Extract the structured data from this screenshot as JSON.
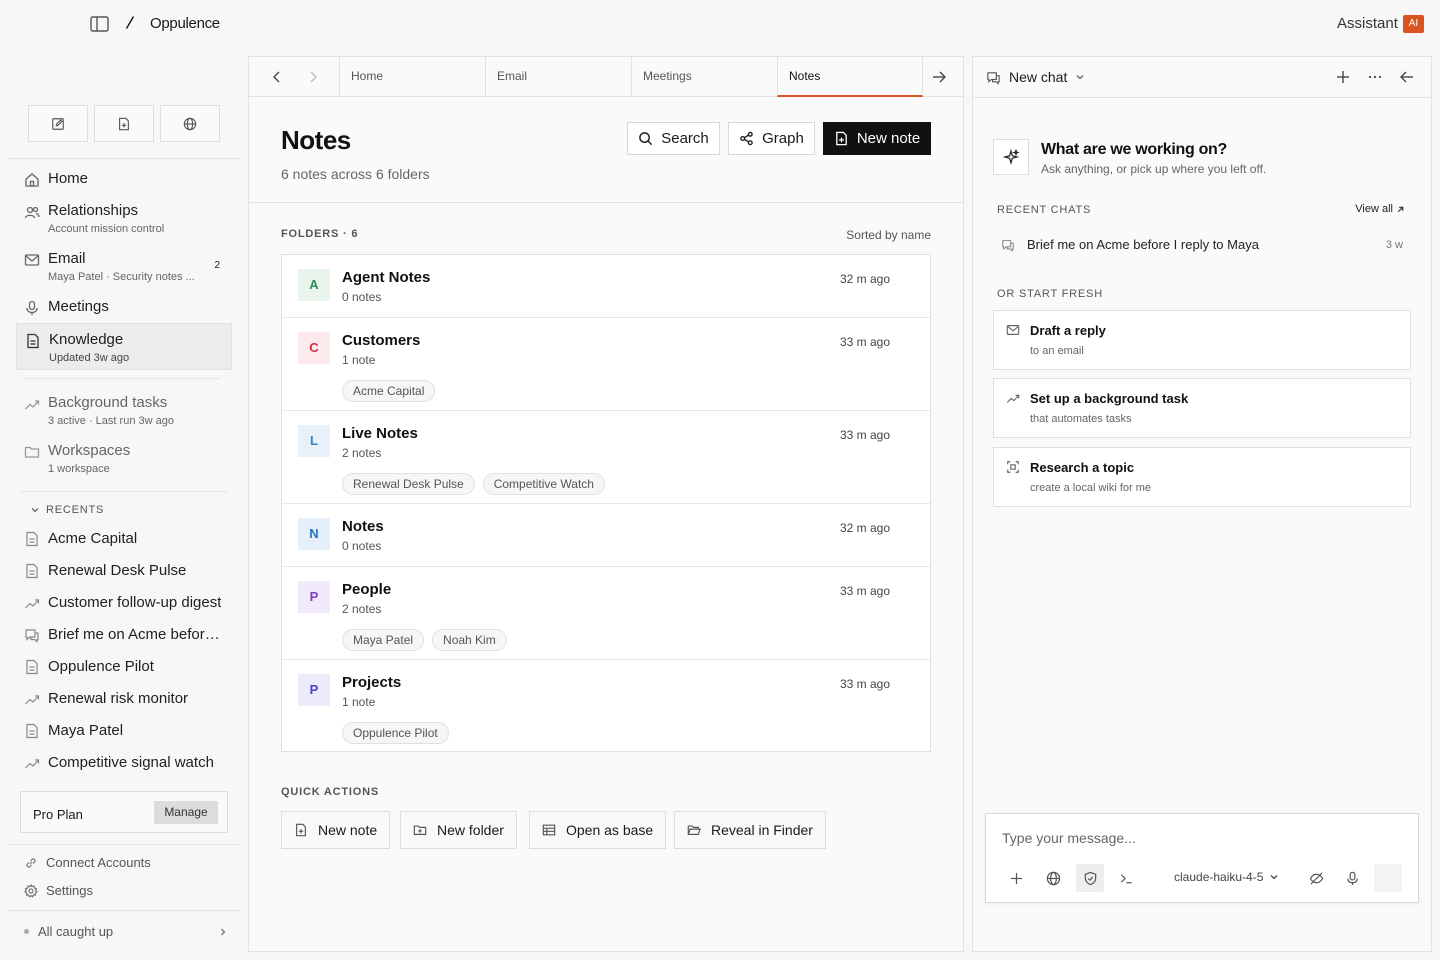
{
  "app": {
    "name": "Oppulence",
    "assistant_label": "Assistant",
    "assistant_badge": "AI"
  },
  "sidebar": {
    "quick_icons": [
      "compose-icon",
      "new-document-icon",
      "globe-icon"
    ],
    "nav": [
      {
        "label": "Home",
        "sub": "",
        "icon": "home-icon"
      },
      {
        "label": "Relationships",
        "sub": "Account mission control",
        "icon": "users-icon"
      },
      {
        "label": "Email",
        "sub": "Maya Patel · Security notes ...",
        "badge": "2",
        "icon": "mail-icon"
      },
      {
        "label": "Meetings",
        "sub": "",
        "icon": "mic-icon"
      },
      {
        "label": "Knowledge",
        "sub": "Updated 3w ago",
        "icon": "document-icon",
        "active": true
      },
      {
        "label": "Background tasks",
        "sub": "3 active · Last run 3w ago",
        "icon": "trend-icon"
      },
      {
        "label": "Workspaces",
        "sub": "1 workspace",
        "icon": "folder-icon"
      }
    ],
    "recents_header": "RECENTS",
    "recents": [
      {
        "label": "Acme Capital",
        "icon": "document-icon"
      },
      {
        "label": "Renewal Desk Pulse",
        "icon": "document-icon"
      },
      {
        "label": "Customer follow-up digest",
        "icon": "trend-icon"
      },
      {
        "label": "Brief me on Acme before I reply to Maya",
        "icon": "chat-icon"
      },
      {
        "label": "Oppulence Pilot",
        "icon": "document-icon"
      },
      {
        "label": "Renewal risk monitor",
        "icon": "trend-icon"
      },
      {
        "label": "Maya Patel",
        "icon": "document-icon"
      },
      {
        "label": "Competitive signal watch",
        "icon": "trend-icon"
      }
    ],
    "plan": {
      "label": "Pro Plan",
      "button": "Manage"
    },
    "footer": {
      "connect": "Connect Accounts",
      "settings": "Settings",
      "status": "All caught up"
    }
  },
  "tabs": [
    {
      "label": "Home",
      "active": false
    },
    {
      "label": "Email",
      "active": false
    },
    {
      "label": "Meetings",
      "active": false
    },
    {
      "label": "Notes",
      "active": true
    }
  ],
  "page": {
    "title": "Notes",
    "subtitle": "6 notes across 6 folders",
    "buttons": {
      "search": "Search",
      "graph": "Graph",
      "new_note": "New note"
    },
    "folders_header": "FOLDERS · 6",
    "sort_label": "Sorted by name",
    "folders": [
      {
        "initial": "A",
        "name": "Agent Notes",
        "count": "0 notes",
        "time": "32 m ago",
        "color": "#2e8b57",
        "bg": "#e8f4ec",
        "chips": []
      },
      {
        "initial": "C",
        "name": "Customers",
        "count": "1 note",
        "time": "33 m ago",
        "color": "#d32f45",
        "bg": "#fbe9ec",
        "chips": [
          "Acme Capital"
        ]
      },
      {
        "initial": "L",
        "name": "Live Notes",
        "count": "2 notes",
        "time": "33 m ago",
        "color": "#3b7ec8",
        "bg": "#e8f1fa",
        "chips": [
          "Renewal Desk Pulse",
          "Competitive Watch"
        ]
      },
      {
        "initial": "N",
        "name": "Notes",
        "count": "0 notes",
        "time": "32 m ago",
        "color": "#2a73c2",
        "bg": "#e6f0fa",
        "chips": []
      },
      {
        "initial": "P",
        "name": "People",
        "count": "2 notes",
        "time": "33 m ago",
        "color": "#7a3fc4",
        "bg": "#f1eafa",
        "chips": [
          "Maya Patel",
          "Noah Kim"
        ]
      },
      {
        "initial": "P",
        "name": "Projects",
        "count": "1 note",
        "time": "33 m ago",
        "color": "#4b3ec4",
        "bg": "#ecebfa",
        "chips": [
          "Oppulence Pilot"
        ]
      }
    ],
    "quick_actions_header": "QUICK ACTIONS",
    "quick_actions": [
      {
        "label": "New note",
        "icon": "new-document-icon"
      },
      {
        "label": "New folder",
        "icon": "new-folder-icon"
      },
      {
        "label": "Open as base",
        "icon": "table-icon"
      },
      {
        "label": "Reveal in Finder",
        "icon": "folder-open-icon"
      }
    ]
  },
  "assistant": {
    "header": "New chat",
    "hero_title": "What are we working on?",
    "hero_sub": "Ask anything, or pick up where you left off.",
    "recent_header": "RECENT CHATS",
    "view_all": "View all",
    "recent_chats": [
      {
        "title": "Brief me on Acme before I reply to Maya",
        "time": "3 w"
      }
    ],
    "fresh_header": "OR START FRESH",
    "suggestions": [
      {
        "title": "Draft a reply",
        "sub": "to an email",
        "icon": "mail-icon"
      },
      {
        "title": "Set up a background task",
        "sub": "that automates tasks",
        "icon": "trend-icon"
      },
      {
        "title": "Research a topic",
        "sub": "create a local wiki for me",
        "icon": "scan-icon"
      }
    ],
    "composer": {
      "placeholder": "Type your message...",
      "model": "claude-haiku-4-5"
    }
  },
  "colors": {
    "accent": "#d9541e",
    "dark_button": "#111111"
  }
}
